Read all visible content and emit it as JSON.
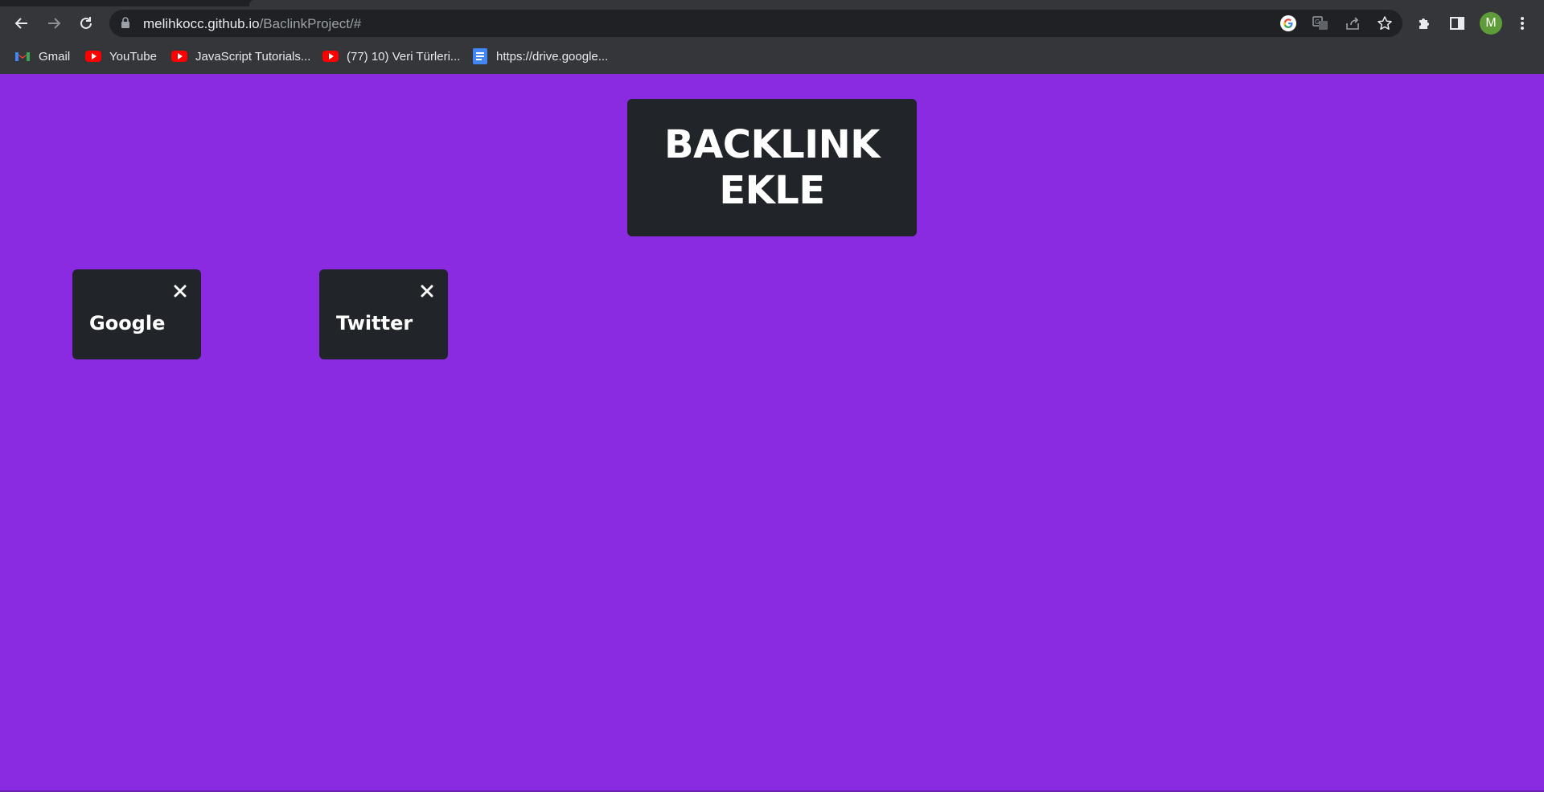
{
  "browser": {
    "url_host": "melihkocc.github.io",
    "url_path": "/BaclinkProject/#",
    "avatar_letter": "M",
    "icons": [
      "back-icon",
      "forward-icon",
      "reload-icon",
      "lock-icon",
      "google-icon",
      "translate-icon",
      "share-icon",
      "star-icon",
      "extensions-icon",
      "side-panel-icon",
      "menu-icon"
    ]
  },
  "bookmarks": [
    {
      "label": "Gmail",
      "icon": "gmail-icon"
    },
    {
      "label": "YouTube",
      "icon": "youtube-icon"
    },
    {
      "label": "JavaScript Tutorials...",
      "icon": "youtube-icon"
    },
    {
      "label": "(77) 10) Veri Türleri...",
      "icon": "youtube-icon"
    },
    {
      "label": "https://drive.google...",
      "icon": "google-docs-icon"
    }
  ],
  "page": {
    "background": "#8a2be2",
    "add_button_label": "BACKLINK EKLE",
    "links": [
      {
        "name": "Google"
      },
      {
        "name": "Twitter"
      }
    ],
    "close_symbol": "×"
  }
}
